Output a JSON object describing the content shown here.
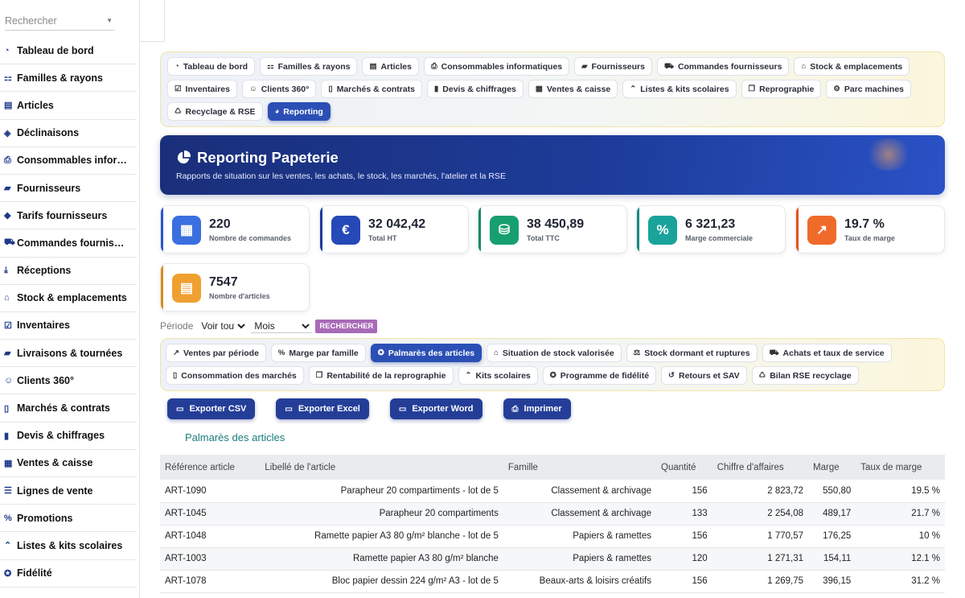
{
  "sidebar": {
    "search_placeholder": "Rechercher",
    "items": [
      {
        "label": "Tableau de bord",
        "icon": "gauge-icon"
      },
      {
        "label": "Familles & rayons",
        "icon": "sitemap-icon"
      },
      {
        "label": "Articles",
        "icon": "book-icon"
      },
      {
        "label": "Déclinaisons",
        "icon": "layers-icon"
      },
      {
        "label": "Consommables infor…",
        "icon": "printer-icon"
      },
      {
        "label": "Fournisseurs",
        "icon": "truck-icon"
      },
      {
        "label": "Tarifs fournisseurs",
        "icon": "tag-icon"
      },
      {
        "label": "Commandes fournis…",
        "icon": "cart-icon"
      },
      {
        "label": "Réceptions",
        "icon": "dolly-icon"
      },
      {
        "label": "Stock & emplacements",
        "icon": "warehouse-icon"
      },
      {
        "label": "Inventaires",
        "icon": "clipboard-check-icon"
      },
      {
        "label": "Livraisons & tournées",
        "icon": "truck-icon"
      },
      {
        "label": "Clients 360°",
        "icon": "users-icon"
      },
      {
        "label": "Marchés & contrats",
        "icon": "file-contract-icon"
      },
      {
        "label": "Devis & chiffrages",
        "icon": "file-invoice-icon"
      },
      {
        "label": "Ventes & caisse",
        "icon": "cash-register-icon"
      },
      {
        "label": "Lignes de vente",
        "icon": "list-icon"
      },
      {
        "label": "Promotions",
        "icon": "percent-icon"
      },
      {
        "label": "Listes & kits scolaires",
        "icon": "graduation-cap-icon"
      },
      {
        "label": "Fidélité",
        "icon": "award-icon"
      }
    ]
  },
  "nav": {
    "items": [
      {
        "label": "Tableau de bord",
        "icon": "gauge-icon"
      },
      {
        "label": "Familles & rayons",
        "icon": "sitemap-icon"
      },
      {
        "label": "Articles",
        "icon": "book-icon"
      },
      {
        "label": "Consommables informatiques",
        "icon": "printer-icon"
      },
      {
        "label": "Fournisseurs",
        "icon": "truck-icon"
      },
      {
        "label": "Commandes fournisseurs",
        "icon": "cart-icon"
      },
      {
        "label": "Stock & emplacements",
        "icon": "warehouse-icon"
      },
      {
        "label": "Inventaires",
        "icon": "clipboard-check-icon"
      },
      {
        "label": "Clients 360°",
        "icon": "users-icon"
      },
      {
        "label": "Marchés & contrats",
        "icon": "file-contract-icon"
      },
      {
        "label": "Devis & chiffrages",
        "icon": "file-invoice-icon"
      },
      {
        "label": "Ventes & caisse",
        "icon": "cash-register-icon"
      },
      {
        "label": "Listes & kits scolaires",
        "icon": "graduation-cap-icon"
      },
      {
        "label": "Reprographie",
        "icon": "copy-icon"
      },
      {
        "label": "Parc machines",
        "icon": "gears-icon"
      },
      {
        "label": "Recyclage & RSE",
        "icon": "recycle-icon"
      },
      {
        "label": "Reporting",
        "icon": "pie-chart-icon",
        "active": true
      }
    ]
  },
  "banner": {
    "title": "Reporting Papeterie",
    "subtitle": "Rapports de situation sur les ventes, les achats, le stock, les marchés, l'atelier et la RSE"
  },
  "kpis": [
    {
      "value": "220",
      "label": "Nombre de commandes",
      "icon": "cash-register-icon",
      "color": "#3a6fe0",
      "bar": "#2b55c9"
    },
    {
      "value": "32 042,42",
      "label": "Total HT",
      "icon": "euro-icon",
      "color": "#2649b8",
      "bar": "#1d3a9c"
    },
    {
      "value": "38 450,89",
      "label": "Total TTC",
      "icon": "coins-icon",
      "color": "#17a06f",
      "bar": "#128a5e"
    },
    {
      "value": "6 321,23",
      "label": "Marge commerciale",
      "icon": "percent-icon",
      "color": "#1aa39a",
      "bar": "#138a82"
    },
    {
      "value": "19.7 %",
      "label": "Taux de marge",
      "icon": "chart-line-icon",
      "color": "#f06a2a",
      "bar": "#e0561a"
    },
    {
      "value": "7547",
      "label": "Nombre d'articles",
      "icon": "book-icon",
      "color": "#f0a030",
      "bar": "#d98b1e"
    }
  ],
  "filter": {
    "period_label": "Période",
    "period_value": "Voir tout",
    "granularity_value": "Mois",
    "search_label": "RECHERCHER"
  },
  "reports": {
    "items": [
      {
        "label": "Ventes par période",
        "icon": "chart-line-icon"
      },
      {
        "label": "Marge par famille",
        "icon": "percent-icon"
      },
      {
        "label": "Palmarès des articles",
        "icon": "award-icon",
        "active": true
      },
      {
        "label": "Situation de stock valorisée",
        "icon": "warehouse-icon"
      },
      {
        "label": "Stock dormant et ruptures",
        "icon": "scale-icon"
      },
      {
        "label": "Achats et taux de service",
        "icon": "cart-icon"
      },
      {
        "label": "Consommation des marchés",
        "icon": "file-contract-icon"
      },
      {
        "label": "Rentabilité de la reprographie",
        "icon": "copy-icon"
      },
      {
        "label": "Kits scolaires",
        "icon": "graduation-cap-icon"
      },
      {
        "label": "Programme de fidélité",
        "icon": "award-icon"
      },
      {
        "label": "Retours et SAV",
        "icon": "undo-icon"
      },
      {
        "label": "Bilan RSE recyclage",
        "icon": "recycle-icon"
      }
    ]
  },
  "exports": [
    {
      "label": "Exporter CSV",
      "icon": "file-csv-icon"
    },
    {
      "label": "Exporter Excel",
      "icon": "file-excel-icon"
    },
    {
      "label": "Exporter Word",
      "icon": "file-word-icon"
    },
    {
      "label": "Imprimer",
      "icon": "printer-icon"
    }
  ],
  "section_title": "Palmarès des articles",
  "table": {
    "headers": [
      "Référence article",
      "Libellé de l'article",
      "Famille",
      "Quantité",
      "Chiffre d'affaires",
      "Marge",
      "Taux de marge"
    ],
    "rows": [
      [
        "ART-1090",
        "Parapheur 20 compartiments - lot de 5",
        "Classement & archivage",
        "156",
        "2 823,72",
        "550,80",
        "19.5 %"
      ],
      [
        "ART-1045",
        "Parapheur 20 compartiments",
        "Classement & archivage",
        "133",
        "2 254,08",
        "489,17",
        "21.7 %"
      ],
      [
        "ART-1048",
        "Ramette papier A3 80 g/m² blanche - lot de 5",
        "Papiers & ramettes",
        "156",
        "1 770,57",
        "176,25",
        "10 %"
      ],
      [
        "ART-1003",
        "Ramette papier A3 80 g/m² blanche",
        "Papiers & ramettes",
        "120",
        "1 271,31",
        "154,11",
        "12.1 %"
      ],
      [
        "ART-1078",
        "Bloc papier dessin 224 g/m² A3 - lot de 5",
        "Beaux-arts & loisirs créatifs",
        "156",
        "1 269,75",
        "396,15",
        "31.2 %"
      ]
    ]
  }
}
